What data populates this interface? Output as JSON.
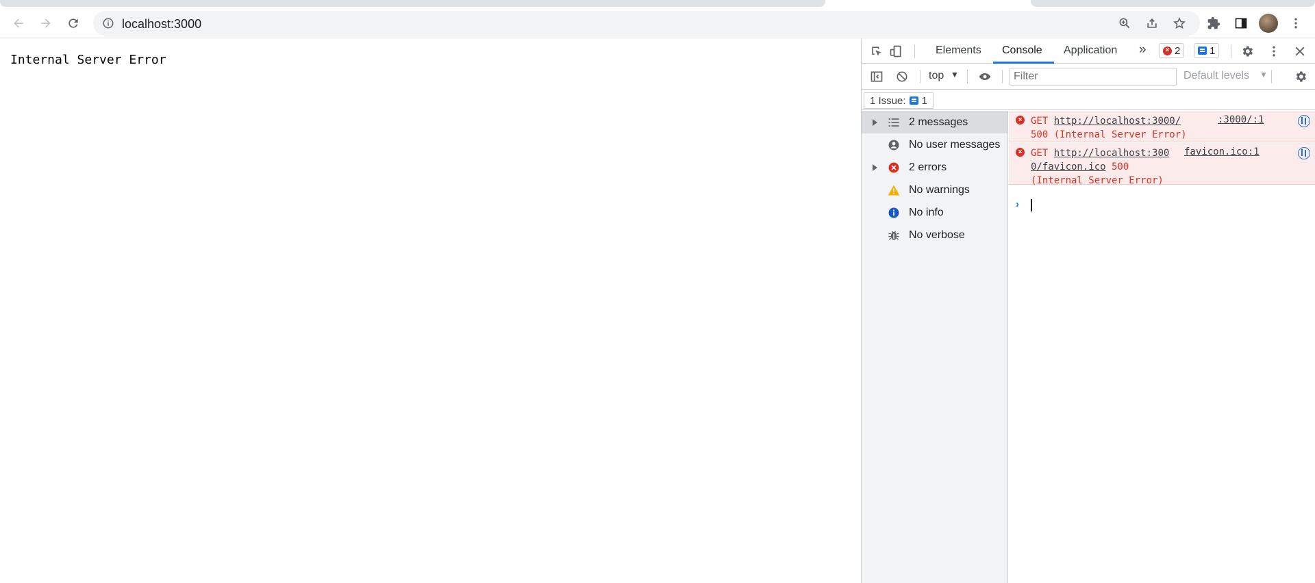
{
  "browser": {
    "url": "localhost:3000"
  },
  "page": {
    "error_text": "Internal Server Error"
  },
  "devtools": {
    "tabs": [
      {
        "label": "Elements"
      },
      {
        "label": "Console"
      },
      {
        "label": "Application"
      }
    ],
    "active_tab": "Console",
    "more_tabs_label": "»",
    "error_count": "2",
    "message_count": "1",
    "toolbar": {
      "context": "top",
      "filter_placeholder": "Filter",
      "levels": "Default levels"
    },
    "issues": {
      "label": "1 Issue:",
      "count": "1"
    },
    "sidebar": [
      {
        "label": "2 messages",
        "icon": "list-icon"
      },
      {
        "label": "No user messages",
        "icon": "user-icon"
      },
      {
        "label": "2 errors",
        "icon": "error-icon"
      },
      {
        "label": "No warnings",
        "icon": "warning-icon"
      },
      {
        "label": "No info",
        "icon": "info-icon"
      },
      {
        "label": "No verbose",
        "icon": "bug-icon"
      }
    ],
    "console": [
      {
        "method": "GET",
        "url_line1": "http://localhost:3000/",
        "rest_line1": "",
        "line2": "500 (Internal Server Error)",
        "line3": "",
        "source": ":3000/:1"
      },
      {
        "method": "GET",
        "url_line1": "http://localhost:300",
        "url_line2": "0/favicon.ico",
        "rest_line2": " 500",
        "line3": "(Internal Server Error)",
        "source": "favicon.ico:1"
      }
    ]
  },
  "colors": {
    "accent": "#1a73e8",
    "error": "#d93025",
    "error_bg": "#fcebeb"
  }
}
